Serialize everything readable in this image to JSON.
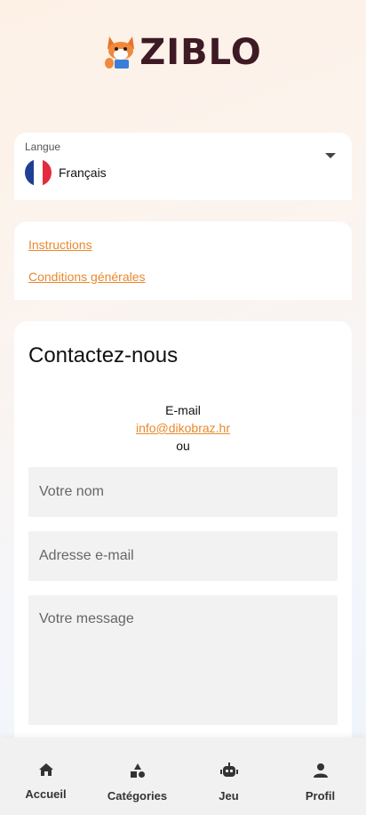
{
  "app": {
    "logo_text": "ZIBLO",
    "logo_color": "#3d1a24",
    "accent_color": "#e8892e"
  },
  "language": {
    "label": "Langue",
    "selected": "Français",
    "flag_icon": "france-flag-icon"
  },
  "links": {
    "instructions": "Instructions",
    "terms": "Conditions générales"
  },
  "contact": {
    "title": "Contactez-nous",
    "email_label": "E-mail",
    "email_address": "info@dikobraz.hr",
    "or_text": "ou",
    "name_placeholder": "Votre nom",
    "email_placeholder": "Adresse e-mail",
    "message_placeholder": "Votre message"
  },
  "nav": {
    "items": [
      {
        "label": "Accueil",
        "icon": "home-icon"
      },
      {
        "label": "Catégories",
        "icon": "shapes-icon"
      },
      {
        "label": "Jeu",
        "icon": "robot-icon"
      },
      {
        "label": "Profil",
        "icon": "person-icon"
      }
    ]
  }
}
